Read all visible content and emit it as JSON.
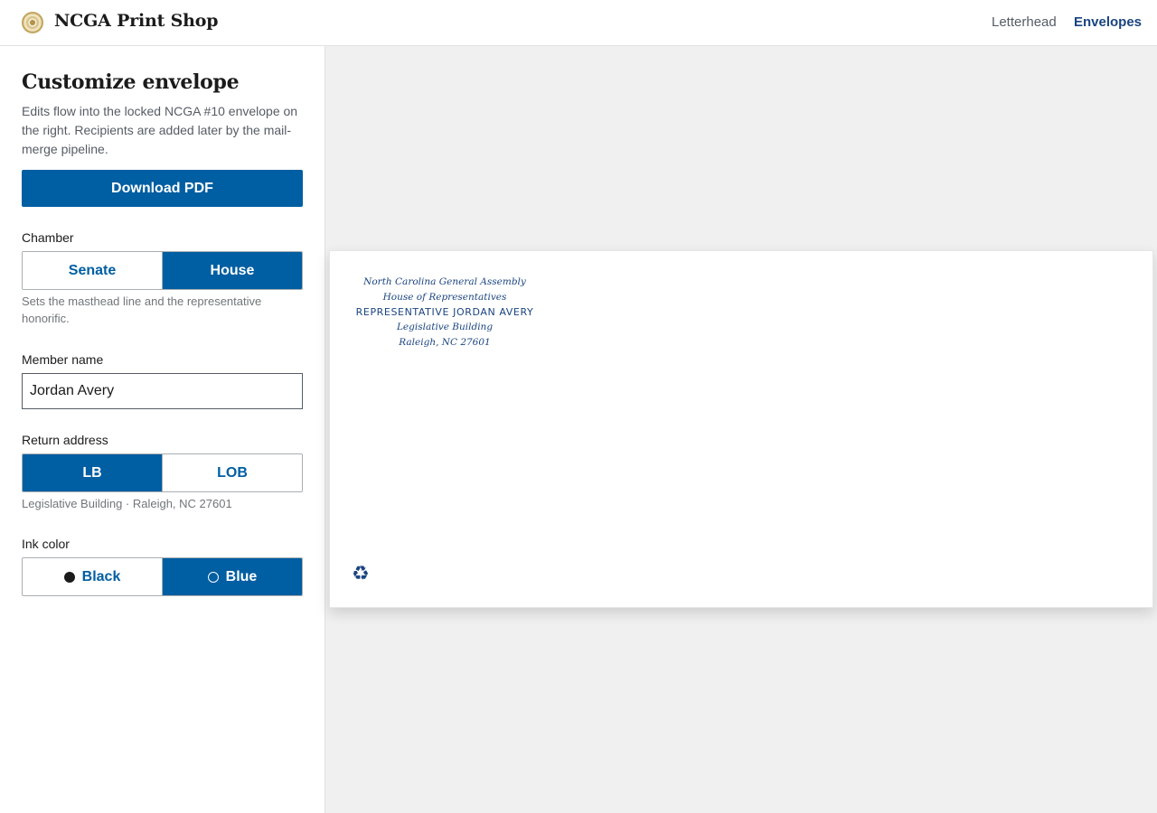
{
  "header": {
    "brand": "NCGA Print Shop",
    "nav": [
      {
        "label": "Letterhead",
        "active": false
      },
      {
        "label": "Envelopes",
        "active": true
      }
    ]
  },
  "sidebar": {
    "title": "Customize envelope",
    "description": "Edits flow into the locked NCGA #10 envelope on the right. Recipients are added later by the mail-merge pipeline.",
    "download_label": "Download PDF",
    "chamber": {
      "label": "Chamber",
      "options": [
        "Senate",
        "House"
      ],
      "selected": "House",
      "help": "Sets the masthead line and the representative honorific."
    },
    "member": {
      "label": "Member name",
      "value": "Jordan Avery"
    },
    "return_address": {
      "label": "Return address",
      "options": [
        "LB",
        "LOB"
      ],
      "selected": "LB",
      "help": "Legislative Building · Raleigh, NC 27601"
    },
    "ink": {
      "label": "Ink color",
      "options": [
        "Black",
        "Blue"
      ],
      "selected": "Blue"
    }
  },
  "envelope": {
    "line1": "North Carolina General Assembly",
    "line2": "House of Representatives",
    "name_line": "REPRESENTATIVE JORDAN AVERY",
    "line3": "Legislative Building",
    "line4": "Raleigh, NC 27601",
    "recycle_icon": "♻"
  },
  "colors": {
    "primary": "#005ea2",
    "ink_blue": "#1a4480",
    "preview_bg": "#f0f0f0"
  }
}
